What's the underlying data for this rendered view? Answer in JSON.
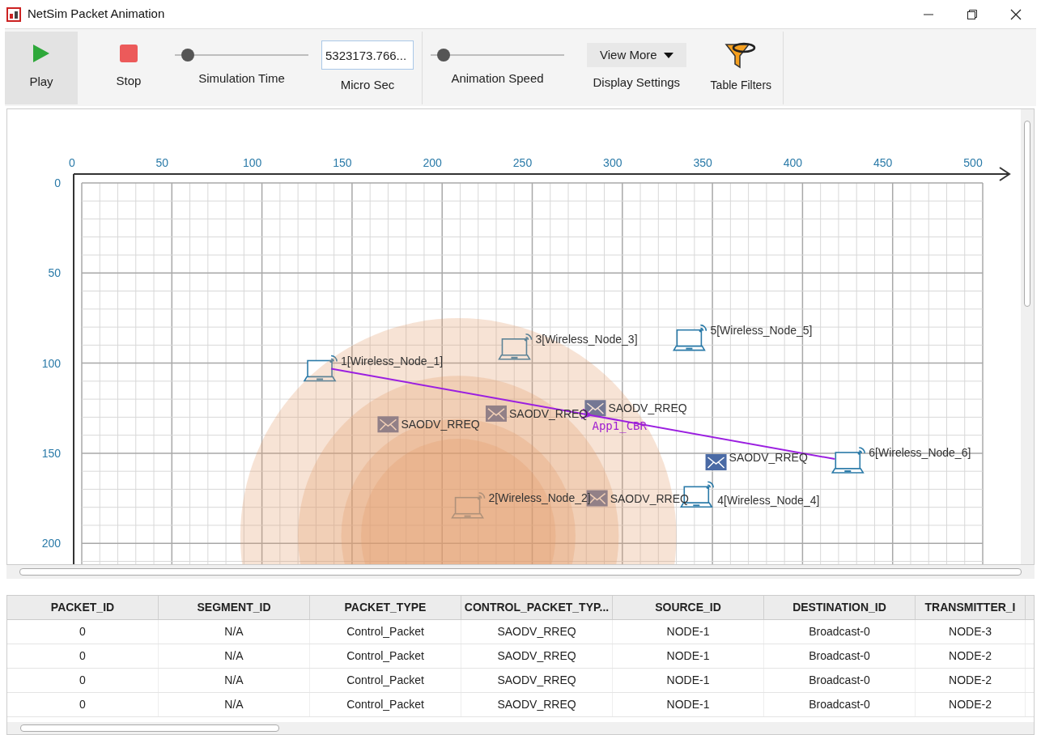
{
  "window": {
    "title": "NetSim Packet Animation"
  },
  "toolbar": {
    "play": {
      "label": "Play",
      "active": true
    },
    "stop": {
      "label": "Stop",
      "active": false
    },
    "simulation_time": {
      "label": "Simulation Time",
      "level": 0.05
    },
    "time_field": {
      "value": "5323173.766...",
      "label": "Micro Sec"
    },
    "animation_speed": {
      "label": "Animation Speed",
      "level": 0.05
    },
    "display_settings": {
      "dropdown": "View More",
      "label": "Display Settings"
    },
    "table_filters": {
      "label": "Table Filters"
    }
  },
  "canvas": {
    "x_axis_labels": [
      "0",
      "50",
      "100",
      "150",
      "200",
      "250",
      "300",
      "350",
      "400",
      "450",
      "500"
    ],
    "y_axis_labels": [
      "0",
      "50",
      "100",
      "150",
      "200"
    ],
    "nodes": [
      {
        "label": "1[Wireless_Node_1]"
      },
      {
        "label": "3[Wireless_Node_3]"
      },
      {
        "label": "5[Wireless_Node_5]"
      },
      {
        "label": "6[Wireless_Node_6]"
      },
      {
        "label": "2[Wireless_Node_2]"
      },
      {
        "label": "4[Wireless_Node_4]"
      }
    ],
    "packets": [
      {
        "label": "SAODV_RREQ"
      },
      {
        "label": "SAODV_RREQ"
      },
      {
        "label": "SAODV_RREQ"
      },
      {
        "label": "SAODV_RREQ"
      },
      {
        "label": "SAODV_RREQ"
      }
    ],
    "flow": {
      "label": "App1_CBR"
    }
  },
  "table": {
    "columns": [
      "PACKET_ID",
      "SEGMENT_ID",
      "PACKET_TYPE",
      "CONTROL_PACKET_TYP...",
      "SOURCE_ID",
      "DESTINATION_ID",
      "TRANSMITTER_I"
    ],
    "rows": [
      [
        "0",
        "N/A",
        "Control_Packet",
        "SAODV_RREQ",
        "NODE-1",
        "Broadcast-0",
        "NODE-3"
      ],
      [
        "0",
        "N/A",
        "Control_Packet",
        "SAODV_RREQ",
        "NODE-1",
        "Broadcast-0",
        "NODE-2"
      ],
      [
        "0",
        "N/A",
        "Control_Packet",
        "SAODV_RREQ",
        "NODE-1",
        "Broadcast-0",
        "NODE-2"
      ],
      [
        "0",
        "N/A",
        "Control_Packet",
        "SAODV_RREQ",
        "NODE-1",
        "Broadcast-0",
        "NODE-2"
      ]
    ]
  }
}
